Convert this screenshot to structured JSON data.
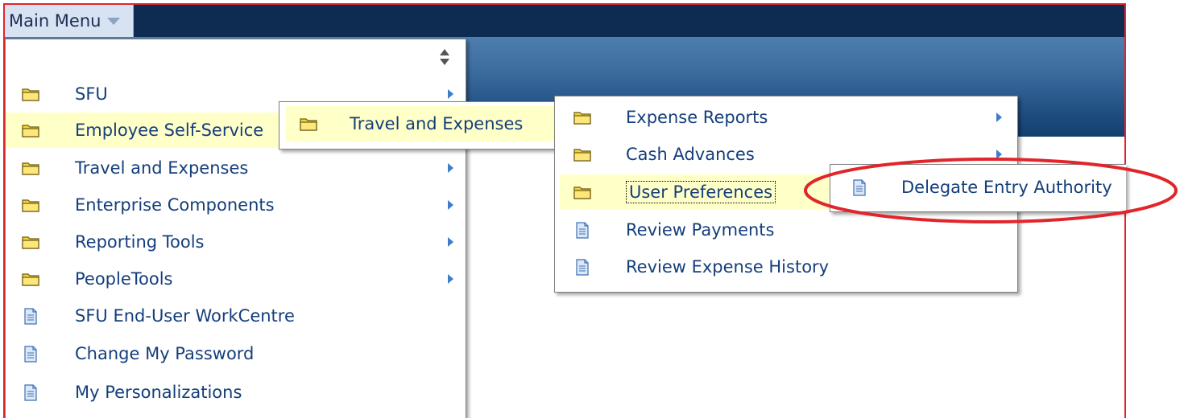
{
  "main_menu": {
    "label": "Main Menu",
    "items": [
      {
        "label": "SFU",
        "icon": "folder-icon",
        "has_submenu": true
      },
      {
        "label": "Employee Self-Service",
        "icon": "folder-icon",
        "has_submenu": true,
        "highlighted": true
      },
      {
        "label": "Travel and Expenses",
        "icon": "folder-icon",
        "has_submenu": true
      },
      {
        "label": "Enterprise Components",
        "icon": "folder-icon",
        "has_submenu": true
      },
      {
        "label": "Reporting Tools",
        "icon": "folder-icon",
        "has_submenu": true
      },
      {
        "label": "PeopleTools",
        "icon": "folder-icon",
        "has_submenu": true
      },
      {
        "label": "SFU End-User WorkCentre",
        "icon": "page-icon",
        "has_submenu": false
      },
      {
        "label": "Change My Password",
        "icon": "page-icon",
        "has_submenu": false
      },
      {
        "label": "My Personalizations",
        "icon": "page-icon",
        "has_submenu": false
      }
    ]
  },
  "ess_submenu": {
    "items": [
      {
        "label": "Travel and Expenses",
        "icon": "folder-icon",
        "highlighted": true
      }
    ]
  },
  "te_submenu": {
    "items": [
      {
        "label": "Expense Reports",
        "icon": "folder-icon",
        "has_submenu": true
      },
      {
        "label": "Cash Advances",
        "icon": "folder-icon",
        "has_submenu": true
      },
      {
        "label": "User Preferences",
        "icon": "folder-icon",
        "has_submenu": true,
        "highlighted": true,
        "focused": true
      },
      {
        "label": "Review Payments",
        "icon": "page-icon",
        "has_submenu": false
      },
      {
        "label": "Review Expense History",
        "icon": "page-icon",
        "has_submenu": false
      }
    ]
  },
  "up_submenu": {
    "items": [
      {
        "label": "Delegate Entry Authority",
        "icon": "page-icon"
      }
    ]
  },
  "colors": {
    "topbar": "#0e2b52",
    "menu_highlight": "#ffffc8",
    "link_text": "#143e7c",
    "annotation": "#e0252b",
    "folder": "#f5d33a"
  }
}
